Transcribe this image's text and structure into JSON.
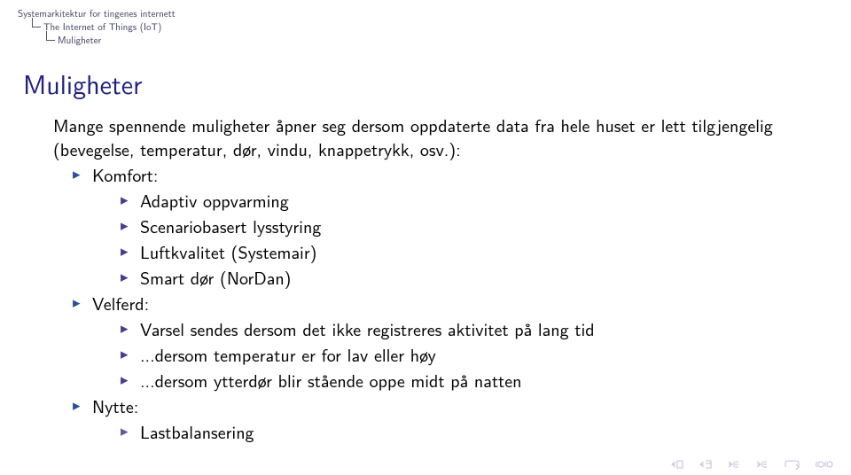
{
  "breadcrumbs": {
    "root": "Systemarkitektur for tingenes internett",
    "level1": "The Internet of Things (IoT)",
    "level2": "Muligheter"
  },
  "title": "Muligheter",
  "intro": "Mange spennende muligheter åpner seg dersom oppdaterte data fra hele huset er lett tilgjengelig (bevegelse, temperatur, dør, vindu, knappetrykk, osv.):",
  "items": [
    {
      "label": "Komfort:",
      "children": [
        {
          "label": "Adaptiv oppvarming"
        },
        {
          "label": "Scenariobasert lysstyring"
        },
        {
          "label": "Luftkvalitet (Systemair)"
        },
        {
          "label": "Smart dør (NorDan)"
        }
      ]
    },
    {
      "label": "Velferd:",
      "children": [
        {
          "label": "Varsel sendes dersom det ikke registreres aktivitet på lang tid"
        },
        {
          "label": "...dersom temperatur er for lav eller høy"
        },
        {
          "label": "...dersom ytterdør blir stående oppe midt på natten"
        }
      ]
    },
    {
      "label": "Nytte:",
      "children": [
        {
          "label": "Lastbalansering"
        }
      ]
    }
  ],
  "nav": {
    "first": "first-slide",
    "prev": "previous-slide",
    "next": "next-slide",
    "last": "last-slide",
    "back": "go-back",
    "repeat": "repeat"
  }
}
